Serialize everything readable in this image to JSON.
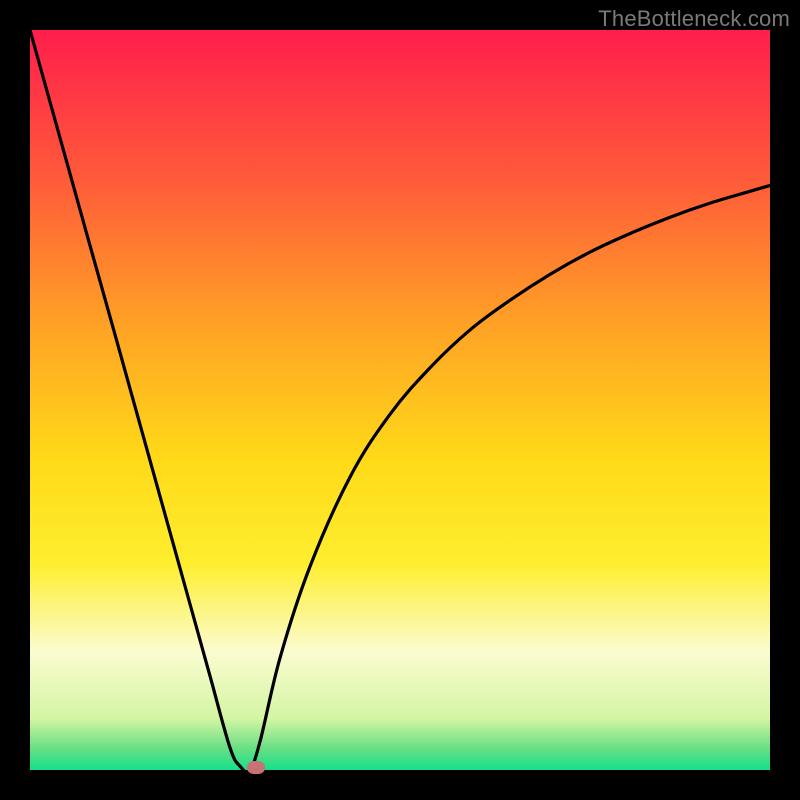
{
  "watermark": {
    "text": "TheBottleneck.com"
  },
  "chart_data": {
    "type": "line",
    "title": "",
    "xlabel": "",
    "ylabel": "",
    "xlim": [
      0,
      100
    ],
    "ylim": [
      0,
      100
    ],
    "grid": false,
    "legend": false,
    "description": "Single black V-shaped bottleneck curve over a vertical rainbow gradient (red at top through orange, yellow, pale-yellow to green at bottom). A small rounded salmon marker sits at the curve minimum.",
    "background_gradient_stops": [
      {
        "pct": 0,
        "color": "#ff1e4c"
      },
      {
        "pct": 20,
        "color": "#ff5a3a"
      },
      {
        "pct": 40,
        "color": "#ffa225"
      },
      {
        "pct": 58,
        "color": "#ffda18"
      },
      {
        "pct": 72,
        "color": "#feee2e"
      },
      {
        "pct": 84,
        "color": "#fbfccf"
      },
      {
        "pct": 93,
        "color": "#d4f5a4"
      },
      {
        "pct": 97,
        "color": "#6bdf84"
      },
      {
        "pct": 100,
        "color": "#14e08b"
      }
    ],
    "series": [
      {
        "name": "bottleneck-curve",
        "color": "#000000",
        "x": [
          0.0,
          2.7,
          5.4,
          8.1,
          10.8,
          13.5,
          16.2,
          18.9,
          21.6,
          24.3,
          27.0,
          28.4,
          29.7,
          31.1,
          33.8,
          37.8,
          43.2,
          48.6,
          54.1,
          59.5,
          64.9,
          70.3,
          75.7,
          81.1,
          86.5,
          91.9,
          97.3,
          100.0
        ],
        "y": [
          100.0,
          90.3,
          80.6,
          70.9,
          61.3,
          51.6,
          41.9,
          32.2,
          22.5,
          12.8,
          3.1,
          0.5,
          0.0,
          3.9,
          15.2,
          27.4,
          39.5,
          48.0,
          54.4,
          59.5,
          63.5,
          67.0,
          70.0,
          72.5,
          74.7,
          76.6,
          78.2,
          79.0
        ]
      }
    ],
    "marker": {
      "x": 30.5,
      "y": 0.0,
      "color": "#c77373"
    }
  }
}
